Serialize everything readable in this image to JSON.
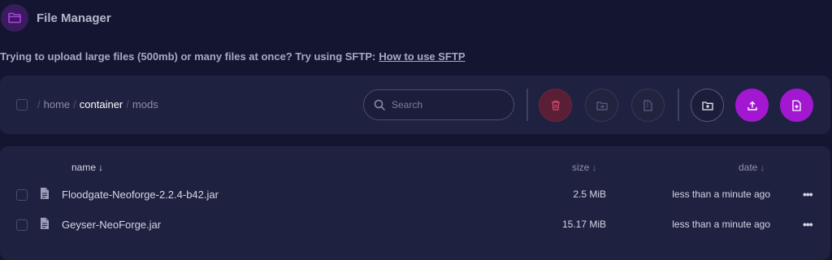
{
  "header": {
    "title": "File Manager",
    "icon": "folder-icon",
    "accent": "#a218d1"
  },
  "notice": {
    "text": "Trying to upload large files (500mb) or many files at once? Try using SFTP:",
    "link": "How to use SFTP"
  },
  "breadcrumb": {
    "sep": "/",
    "parts": [
      "home",
      "container",
      "mods"
    ]
  },
  "search": {
    "placeholder": "Search"
  },
  "toolbar": {
    "buttons": [
      "delete",
      "move",
      "archive",
      "new-folder",
      "upload",
      "new-file"
    ],
    "colors": {
      "delete": "#5b1f35",
      "primary": "#a218d1"
    }
  },
  "columns": {
    "name": "name",
    "size": "size",
    "date": "date",
    "arrow": "↓"
  },
  "files": [
    {
      "name": "Floodgate-Neoforge-2.2.4-b42.jar",
      "size": "2.5 MiB",
      "date": "less than a minute ago",
      "more": "•••"
    },
    {
      "name": "Geyser-NeoForge.jar",
      "size": "15.17 MiB",
      "date": "less than a minute ago",
      "more": "•••"
    }
  ]
}
